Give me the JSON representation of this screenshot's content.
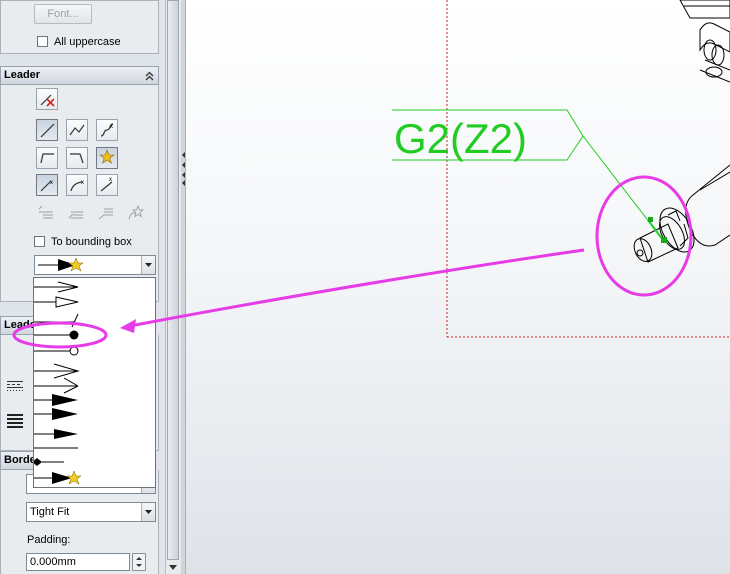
{
  "text_format": {
    "font_button": "Font...",
    "all_uppercase_label": "All uppercase"
  },
  "leader": {
    "title": "Leader",
    "to_bounding_box_label": "To bounding box",
    "arrow_style_selected": "filled-arrow-with-star",
    "arrow_styles": [
      "open-arrow",
      "open-triangle",
      "slash",
      "dot",
      "open-circle",
      "open-arrow-long",
      "single-barb-arrow",
      "filled-triangle",
      "filled-triangle-large",
      "filled-triangle-small",
      "none",
      "diamond",
      "filled-arrow-with-star"
    ]
  },
  "leader_style": {
    "title_fragment": "Leade"
  },
  "border": {
    "title_fragment": "Borde",
    "size_value": "Tight Fit",
    "padding_label": "Padding:",
    "padding_value": "0.000mm"
  },
  "canvas": {
    "note_text": "G2(Z2)",
    "note_color": "#22cc22",
    "annotation_color": "#e83be8",
    "sketch_line_color": "#cc2222"
  }
}
